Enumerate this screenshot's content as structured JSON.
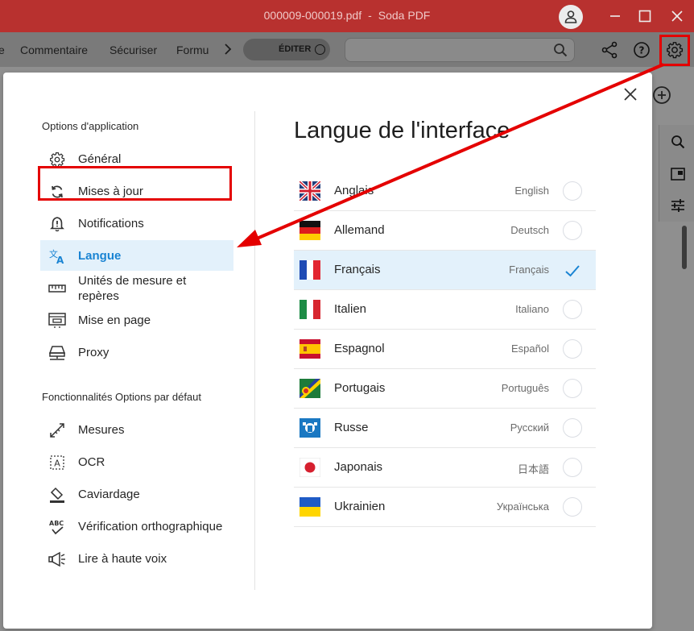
{
  "window": {
    "filename": "000009-000019.pdf",
    "separator": "-",
    "app_name": "Soda PDF"
  },
  "toolbar": {
    "items": [
      "e",
      "Commentaire",
      "Sécuriser",
      "Formu"
    ],
    "edit_label": "ÉDITER",
    "search_value": ""
  },
  "dialog": {
    "sidebar": {
      "section1_title": "Options d'application",
      "section1_items": [
        {
          "label": "Général",
          "icon": "gear-icon"
        },
        {
          "label": "Mises à jour",
          "icon": "sync-icon"
        },
        {
          "label": "Notifications",
          "icon": "bell-alert-icon"
        },
        {
          "label": "Langue",
          "icon": "translate-icon",
          "active": true
        },
        {
          "label": "Unités de mesure et repères",
          "icon": "ruler-icon"
        },
        {
          "label": "Mise en page",
          "icon": "page-layout-icon"
        },
        {
          "label": "Proxy",
          "icon": "proxy-icon"
        }
      ],
      "section2_title": "Fonctionnalités Options par défaut",
      "section2_items": [
        {
          "label": "Mesures",
          "icon": "measure-icon"
        },
        {
          "label": "OCR",
          "icon": "ocr-icon"
        },
        {
          "label": "Caviardage",
          "icon": "eraser-icon"
        },
        {
          "label": "Vérification orthographique",
          "icon": "spellcheck-icon"
        },
        {
          "label": "Lire à haute voix",
          "icon": "megaphone-icon"
        }
      ]
    },
    "pane": {
      "title": "Langue de l'interface",
      "languages": [
        {
          "name": "Anglais",
          "native": "English",
          "flag": "uk",
          "selected": false
        },
        {
          "name": "Allemand",
          "native": "Deutsch",
          "flag": "de",
          "selected": false
        },
        {
          "name": "Français",
          "native": "Français",
          "flag": "fr",
          "selected": true
        },
        {
          "name": "Italien",
          "native": "Italiano",
          "flag": "it",
          "selected": false
        },
        {
          "name": "Espagnol",
          "native": "Español",
          "flag": "es",
          "selected": false
        },
        {
          "name": "Portugais",
          "native": "Português",
          "flag": "pt",
          "selected": false
        },
        {
          "name": "Russe",
          "native": "Русский",
          "flag": "ru",
          "selected": false
        },
        {
          "name": "Japonais",
          "native": "日本語",
          "flag": "jp",
          "selected": false
        },
        {
          "name": "Ukrainien",
          "native": "Українська",
          "flag": "ua",
          "selected": false
        }
      ]
    }
  },
  "colors": {
    "titlebar": "#b8312f",
    "accent": "#1a84d3",
    "highlight": "#e40000"
  }
}
